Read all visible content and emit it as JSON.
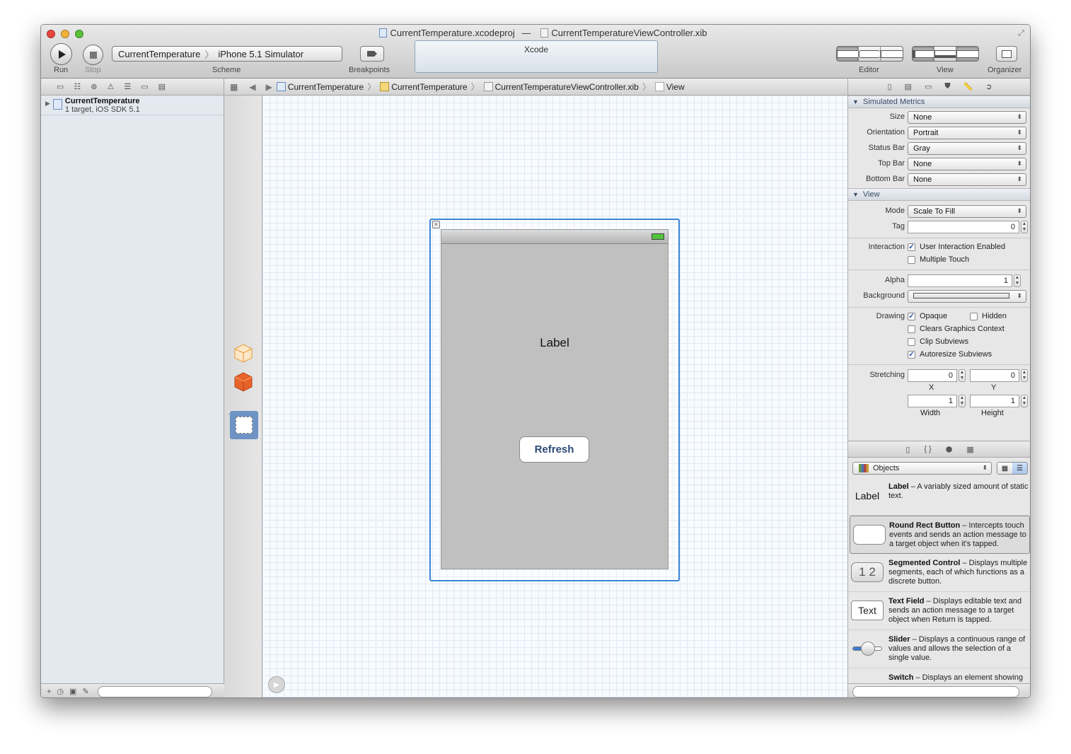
{
  "window": {
    "project_file": "CurrentTemperature.xcodeproj",
    "title_sep": "—",
    "xib_file": "CurrentTemperatureViewController.xib"
  },
  "toolbar": {
    "run_label": "Run",
    "stop_label": "Stop",
    "scheme_target": "CurrentTemperature",
    "scheme_device": "iPhone 5.1 Simulator",
    "scheme_label": "Scheme",
    "breakpoints_label": "Breakpoints",
    "activity_text": "Xcode",
    "editor_label": "Editor",
    "view_label": "View",
    "organizer_label": "Organizer"
  },
  "navigator": {
    "project_name": "CurrentTemperature",
    "project_detail": "1 target, iOS SDK 5.1"
  },
  "jumpbar": {
    "items": [
      "CurrentTemperature",
      "CurrentTemperature",
      "CurrentTemperatureViewController.xib",
      "View"
    ]
  },
  "canvas": {
    "label_text": "Label",
    "button_text": "Refresh"
  },
  "inspector": {
    "simulated_metrics_title": "Simulated Metrics",
    "size_label": "Size",
    "size_value": "None",
    "orientation_label": "Orientation",
    "orientation_value": "Portrait",
    "status_bar_label": "Status Bar",
    "status_bar_value": "Gray",
    "top_bar_label": "Top Bar",
    "top_bar_value": "None",
    "bottom_bar_label": "Bottom Bar",
    "bottom_bar_value": "None",
    "view_title": "View",
    "mode_label": "Mode",
    "mode_value": "Scale To Fill",
    "tag_label": "Tag",
    "tag_value": "0",
    "interaction_label": "Interaction",
    "user_interaction_label": "User Interaction Enabled",
    "user_interaction_checked": true,
    "multiple_touch_label": "Multiple Touch",
    "multiple_touch_checked": false,
    "alpha_label": "Alpha",
    "alpha_value": "1",
    "background_label": "Background",
    "drawing_label": "Drawing",
    "opaque_label": "Opaque",
    "opaque_checked": true,
    "hidden_label": "Hidden",
    "hidden_checked": false,
    "clears_label": "Clears Graphics Context",
    "clears_checked": false,
    "clip_label": "Clip Subviews",
    "clip_checked": false,
    "autoresize_label": "Autoresize Subviews",
    "autoresize_checked": true,
    "stretching_label": "Stretching",
    "stretch_x": "0",
    "stretch_y": "0",
    "x_label": "X",
    "y_label": "Y",
    "stretch_width": "1",
    "stretch_height": "1",
    "width_label": "Width",
    "height_label": "Height"
  },
  "library": {
    "objects_label": "Objects",
    "items": [
      {
        "thumb": "Label",
        "name": "Label",
        "desc": " – A variably sized amount of static text."
      },
      {
        "thumb": "",
        "name": "Round Rect Button",
        "desc": " – Intercepts touch events and sends an action message to a target object when it's tapped."
      },
      {
        "thumb": "1 2",
        "name": "Segmented Control",
        "desc": " – Displays multiple segments, each of which functions as a discrete button."
      },
      {
        "thumb": "Text",
        "name": "Text Field",
        "desc": " – Displays editable text and sends an action message to a target object when Return is tapped."
      },
      {
        "thumb": "",
        "name": "Slider",
        "desc": " – Displays a continuous range of values and allows the selection of a single value."
      },
      {
        "thumb": "",
        "name": "Switch",
        "desc": " – Displays an element showing"
      }
    ]
  },
  "colors": {
    "selection_blue": "#3b86d8",
    "view_gray": "#c0c0c0"
  }
}
